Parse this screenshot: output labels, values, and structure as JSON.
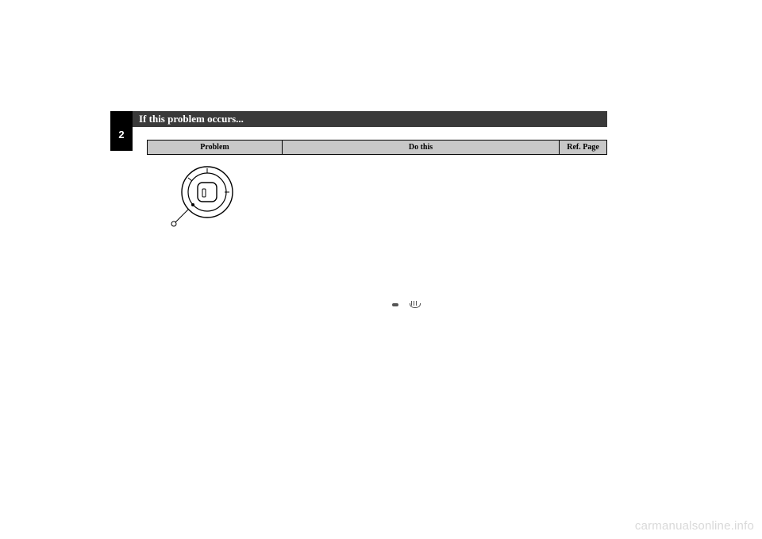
{
  "section": {
    "number": "2",
    "title": "If this problem occurs..."
  },
  "table": {
    "headers": {
      "problem": "Problem",
      "do_this": "Do this",
      "ref_page": "Ref. Page"
    }
  },
  "icons": {
    "ignition_switch": "ignition-switch-diagram",
    "indicator_dash": "indicator-dash-icon",
    "defrost": "defrost-icon"
  },
  "watermark": "carmanualsonline.info"
}
